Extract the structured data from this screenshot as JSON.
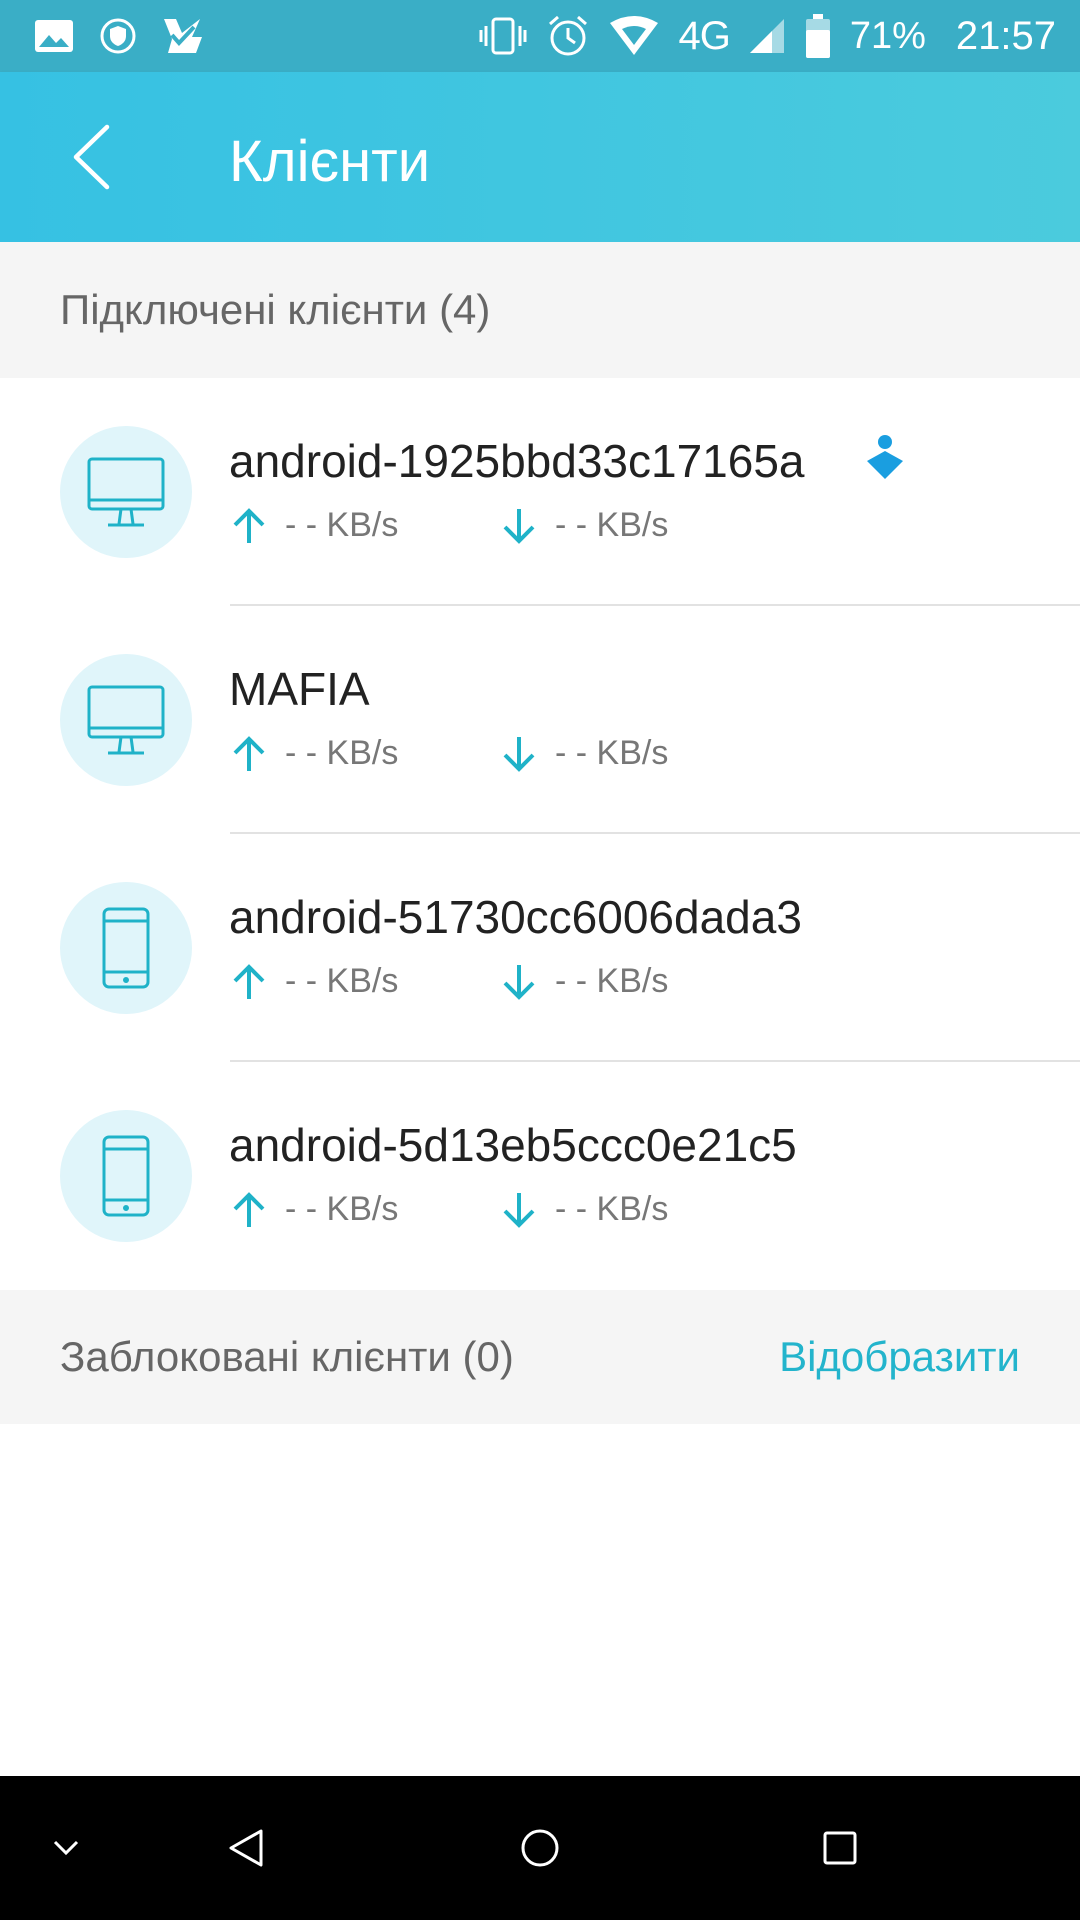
{
  "status_bar": {
    "network": "4G",
    "battery": "71%",
    "time": "21:57",
    "icons": [
      "image-icon",
      "shield-icon",
      "check-app-icon",
      "vibrate-icon",
      "alarm-icon",
      "wifi-icon",
      "signal-icon",
      "battery-icon"
    ]
  },
  "app_bar": {
    "title": "Клієнти",
    "back_icon": "chevron-left-icon"
  },
  "connected_section": {
    "label": "Підключені клієнти (4)"
  },
  "clients": [
    {
      "name": "android-1925bbd33c17165a",
      "device": "desktop-icon",
      "up": "- - KB/s",
      "down": "- - KB/s",
      "badge": "owner-badge-icon"
    },
    {
      "name": "MAFIA",
      "device": "desktop-icon",
      "up": "- - KB/s",
      "down": "- - KB/s"
    },
    {
      "name": "android-51730cc6006dada3",
      "device": "phone-icon",
      "up": "- - KB/s",
      "down": "- - KB/s"
    },
    {
      "name": "android-5d13eb5ccc0e21c5",
      "device": "phone-icon",
      "up": "- - KB/s",
      "down": "- - KB/s"
    }
  ],
  "blocked_section": {
    "label": "Заблоковані клієнти (0)",
    "action": "Відобразити"
  },
  "colors": {
    "accent": "#23b4cc",
    "app_bar": "#3ec5e0",
    "avatar_bg": "#e0f5fa",
    "badge": "#1a9ee0"
  },
  "nav_bar": {
    "icons": [
      "chevron-down-icon",
      "back-triangle-icon",
      "home-circle-icon",
      "recents-square-icon"
    ]
  }
}
